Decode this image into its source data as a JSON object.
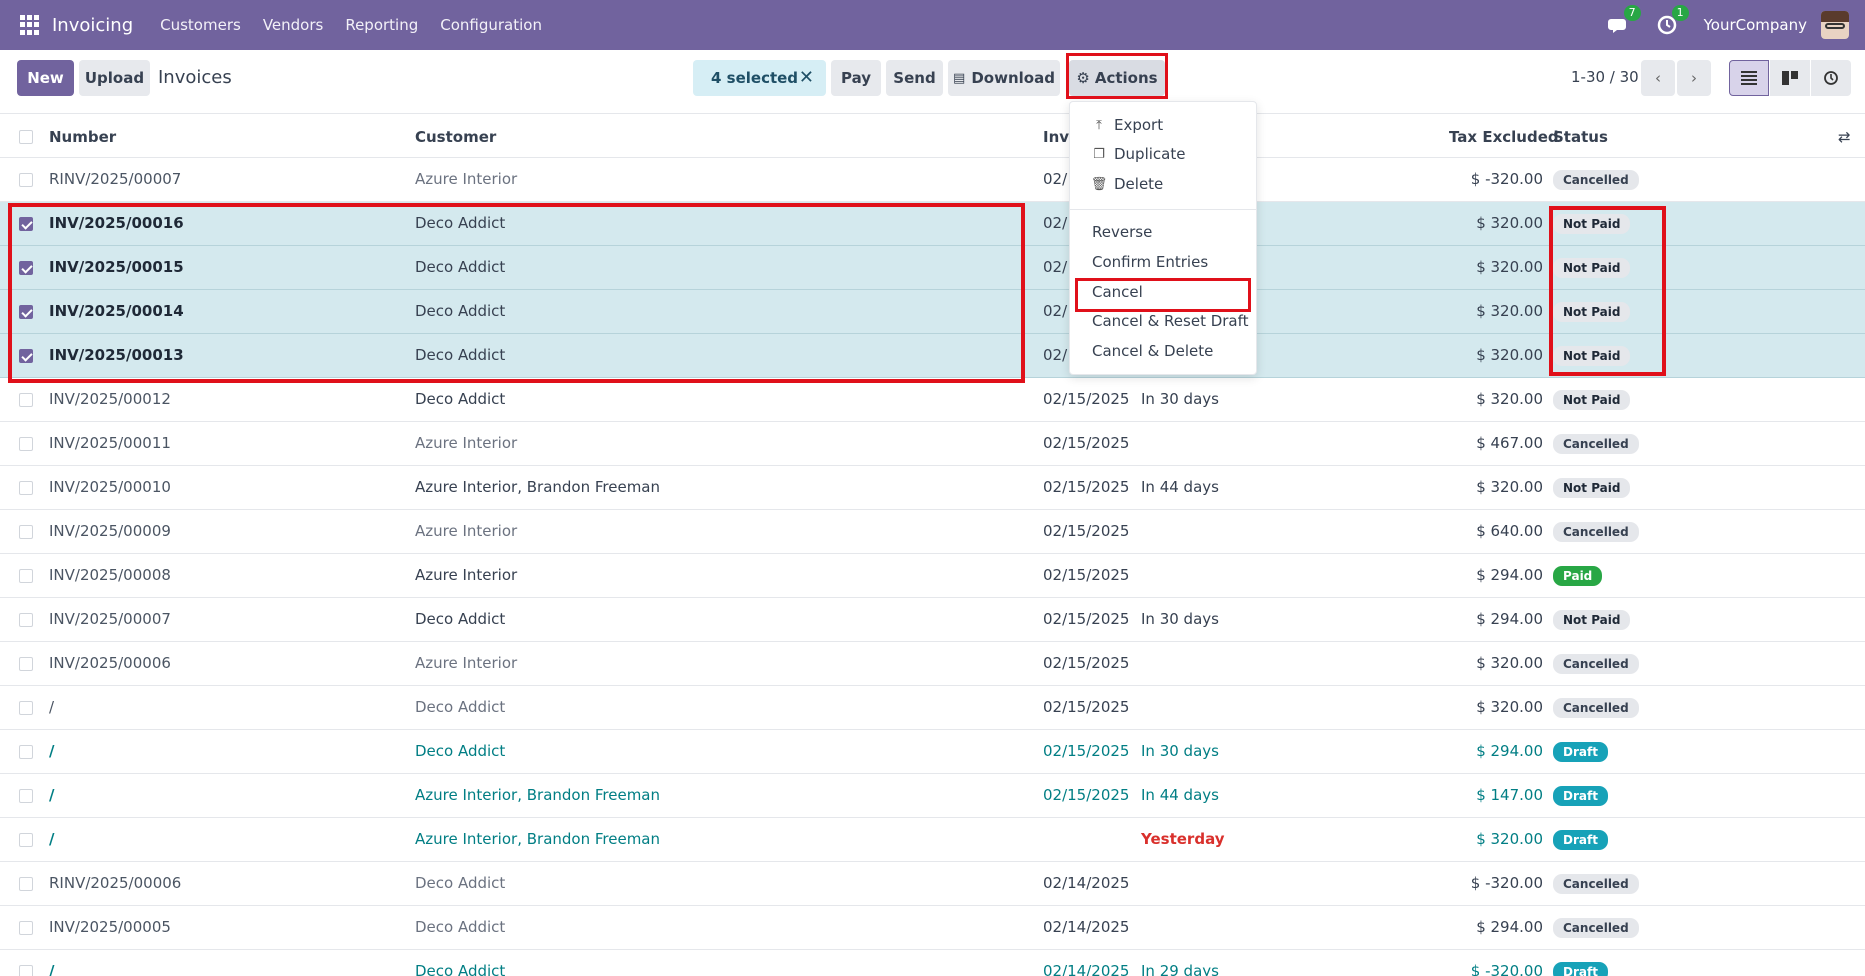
{
  "navbar": {
    "app_title": "Invoicing",
    "menu": [
      "Customers",
      "Vendors",
      "Reporting",
      "Configuration"
    ],
    "messages_count": "7",
    "activities_count": "1",
    "company": "YourCompany",
    "color": "#71639e"
  },
  "control": {
    "new_label": "New",
    "upload_label": "Upload",
    "title": "Invoices",
    "selected_label": "4 selected",
    "pay_label": "Pay",
    "send_label": "Send",
    "download_label": "Download",
    "actions_label": "Actions",
    "pager": "1-30 / 30"
  },
  "table": {
    "headers": {
      "number": "Number",
      "customer": "Customer",
      "invoice_date": "Invo",
      "tax_excluded": "Tax Excluded",
      "status": "Status"
    },
    "rows": [
      {
        "number": "RINV/2025/00007",
        "customer": "Azure Interior",
        "date": "02/",
        "due": "",
        "amount": "$ -320.00",
        "status": "Cancelled"
      },
      {
        "number": "INV/2025/00016",
        "customer": "Deco Addict",
        "date": "02/",
        "due": "",
        "amount": "$ 320.00",
        "status": "Not Paid"
      },
      {
        "number": "INV/2025/00015",
        "customer": "Deco Addict",
        "date": "02/",
        "due": "",
        "amount": "$ 320.00",
        "status": "Not Paid"
      },
      {
        "number": "INV/2025/00014",
        "customer": "Deco Addict",
        "date": "02/",
        "due": "",
        "amount": "$ 320.00",
        "status": "Not Paid"
      },
      {
        "number": "INV/2025/00013",
        "customer": "Deco Addict",
        "date": "02/",
        "due": "",
        "amount": "$ 320.00",
        "status": "Not Paid"
      },
      {
        "number": "INV/2025/00012",
        "customer": "Deco Addict",
        "date": "02/15/2025",
        "due": "In 30 days",
        "amount": "$ 320.00",
        "status": "Not Paid"
      },
      {
        "number": "INV/2025/00011",
        "customer": "Azure Interior",
        "date": "02/15/2025",
        "due": "",
        "amount": "$ 467.00",
        "status": "Cancelled"
      },
      {
        "number": "INV/2025/00010",
        "customer": "Azure Interior, Brandon Freeman",
        "date": "02/15/2025",
        "due": "In 44 days",
        "amount": "$ 320.00",
        "status": "Not Paid"
      },
      {
        "number": "INV/2025/00009",
        "customer": "Azure Interior",
        "date": "02/15/2025",
        "due": "",
        "amount": "$ 640.00",
        "status": "Cancelled"
      },
      {
        "number": "INV/2025/00008",
        "customer": "Azure Interior",
        "date": "02/15/2025",
        "due": "",
        "amount": "$ 294.00",
        "status": "Paid"
      },
      {
        "number": "INV/2025/00007",
        "customer": "Deco Addict",
        "date": "02/15/2025",
        "due": "In 30 days",
        "amount": "$ 294.00",
        "status": "Not Paid"
      },
      {
        "number": "INV/2025/00006",
        "customer": "Azure Interior",
        "date": "02/15/2025",
        "due": "",
        "amount": "$ 320.00",
        "status": "Cancelled"
      },
      {
        "number": "/",
        "customer": "Deco Addict",
        "date": "02/15/2025",
        "due": "",
        "amount": "$ 320.00",
        "status": "Cancelled"
      },
      {
        "number": "/",
        "customer": "Deco Addict",
        "date": "02/15/2025",
        "due": "In 30 days",
        "amount": "$ 294.00",
        "status": "Draft"
      },
      {
        "number": "/",
        "customer": "Azure Interior, Brandon Freeman",
        "date": "02/15/2025",
        "due": "In 44 days",
        "amount": "$ 147.00",
        "status": "Draft"
      },
      {
        "number": "/",
        "customer": "Azure Interior, Brandon Freeman",
        "date": "",
        "due": "Yesterday",
        "amount": "$ 320.00",
        "status": "Draft"
      },
      {
        "number": "RINV/2025/00006",
        "customer": "Deco Addict",
        "date": "02/14/2025",
        "due": "",
        "amount": "$ -320.00",
        "status": "Cancelled"
      },
      {
        "number": "INV/2025/00005",
        "customer": "Deco Addict",
        "date": "02/14/2025",
        "due": "",
        "amount": "$ 294.00",
        "status": "Cancelled"
      },
      {
        "number": "/",
        "customer": "Deco Addict",
        "date": "02/14/2025",
        "due": "In 29 days",
        "amount": "$ -320.00",
        "status": "Draft"
      }
    ]
  },
  "actions_menu": {
    "export": "Export",
    "duplicate": "Duplicate",
    "delete": "Delete",
    "reverse": "Reverse",
    "confirm_entries": "Confirm Entries",
    "cancel": "Cancel",
    "cancel_reset_draft": "Cancel & Reset Draft",
    "cancel_delete": "Cancel & Delete"
  }
}
